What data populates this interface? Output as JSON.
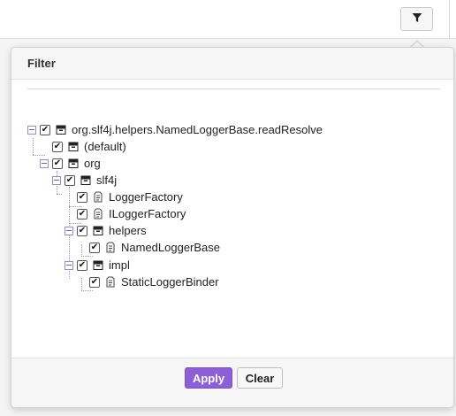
{
  "toolbar": {
    "filter_button_icon": "filter-funnel-icon"
  },
  "panel": {
    "title": "Filter",
    "apply_label": "Apply",
    "clear_label": "Clear"
  },
  "colors": {
    "accent": "#8c5fd6",
    "tree_toggle": "#9a8ac9"
  },
  "tree": [
    {
      "label": "org.slf4j.helpers.NamedLoggerBase.readResolve",
      "icon": "package-icon",
      "checked": true,
      "expanded": true,
      "depth": 0
    },
    {
      "label": "(default)",
      "icon": "package-icon",
      "checked": true,
      "expanded": false,
      "depth": 1
    },
    {
      "label": "org",
      "icon": "package-icon",
      "checked": true,
      "expanded": true,
      "depth": 1
    },
    {
      "label": "slf4j",
      "icon": "package-icon",
      "checked": true,
      "expanded": true,
      "depth": 2
    },
    {
      "label": "LoggerFactory",
      "icon": "class-icon",
      "checked": true,
      "expanded": false,
      "depth": 3
    },
    {
      "label": "ILoggerFactory",
      "icon": "class-icon",
      "checked": true,
      "expanded": false,
      "depth": 3
    },
    {
      "label": "helpers",
      "icon": "package-icon",
      "checked": true,
      "expanded": true,
      "depth": 3
    },
    {
      "label": "NamedLoggerBase",
      "icon": "class-icon",
      "checked": true,
      "expanded": false,
      "depth": 4
    },
    {
      "label": "impl",
      "icon": "package-icon",
      "checked": true,
      "expanded": true,
      "depth": 3
    },
    {
      "label": "StaticLoggerBinder",
      "icon": "class-icon",
      "checked": true,
      "expanded": false,
      "depth": 4
    }
  ]
}
